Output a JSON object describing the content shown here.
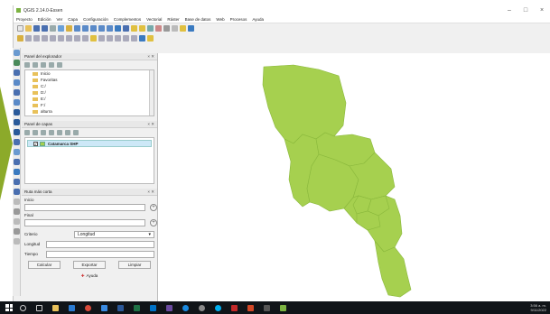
{
  "window": {
    "title": "QGIS 2.14.0-Essen",
    "min_glyph": "–",
    "close_glyph": "×"
  },
  "menu": [
    "Proyecto",
    "Edición",
    "Ver",
    "Capa",
    "Configuración",
    "Complementos",
    "Vectorial",
    "Ráster",
    "Base de datos",
    "Web",
    "Procesos",
    "Ayuda"
  ],
  "browser_panel": {
    "title": "Panel del explorador",
    "close_glyph": "× ✕",
    "items": [
      "Inicio",
      "Favoritas",
      "C:/",
      "D:/",
      "E:/",
      "F:/",
      "alturra"
    ]
  },
  "layers_panel": {
    "title": "Panel de capas",
    "close_glyph": "× ✕",
    "layer": {
      "name": "Catamarca SHP",
      "checked": "✓"
    }
  },
  "shortest_path": {
    "title": "Ruta más corta",
    "close_glyph": "× ✕",
    "start_label": "Inicio",
    "end_label": "Final",
    "criteria_label": "Criterio",
    "criteria_value": "Longitud",
    "length_label": "Longitud",
    "time_label": "Tiempo",
    "calc_button": "Calcular",
    "export_button": "Exportar",
    "clear_button": "Limpiar",
    "help_button": "Ayuda"
  },
  "tray": {
    "time": "3:56 a. m.",
    "date": "9/11/2022"
  },
  "colors": {
    "polygon_fill": "#a6d04f",
    "polygon_stroke": "#8ab83c",
    "arrow": "#8caa2a"
  }
}
